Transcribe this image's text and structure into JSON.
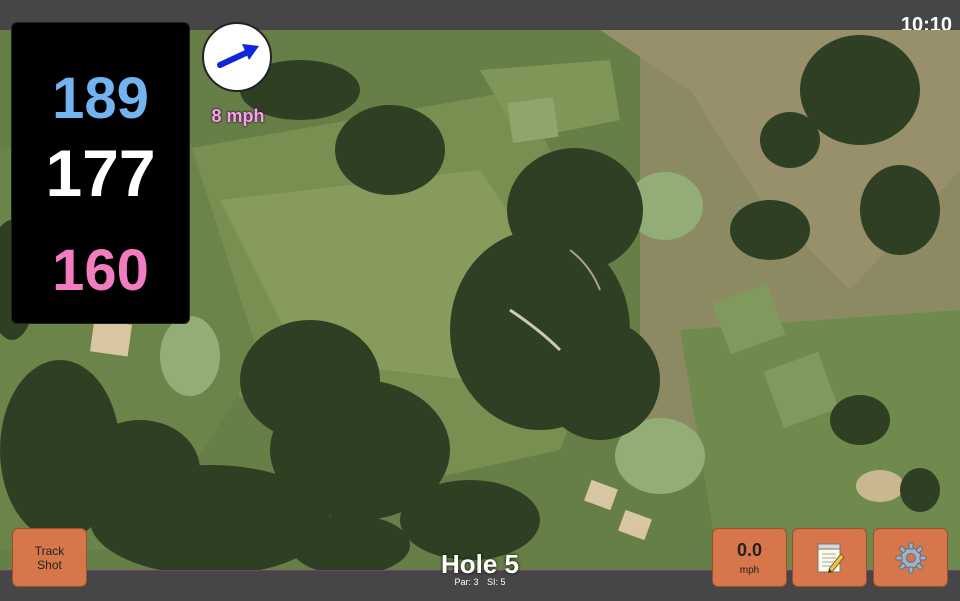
{
  "status": {
    "time": "10:10"
  },
  "distances": {
    "back": "189",
    "middle": "177",
    "front": "160"
  },
  "wind": {
    "speed": "8 mph"
  },
  "buttons": {
    "track_shot": "Track Shot",
    "speed_value": "0.0",
    "speed_unit": "mph"
  },
  "hole": {
    "title": "Hole 5",
    "par": "Par: 3",
    "si": "SI: 5"
  },
  "icons": {
    "wind_arrow": "arrow-icon",
    "notes": "notepad-icon",
    "settings": "gear-icon"
  },
  "colors": {
    "back_distance": "#74b3f2",
    "middle_distance": "#ffffff",
    "front_distance": "#f27cc0",
    "button": "#d6764a",
    "wind_arrow": "#1026d8"
  }
}
